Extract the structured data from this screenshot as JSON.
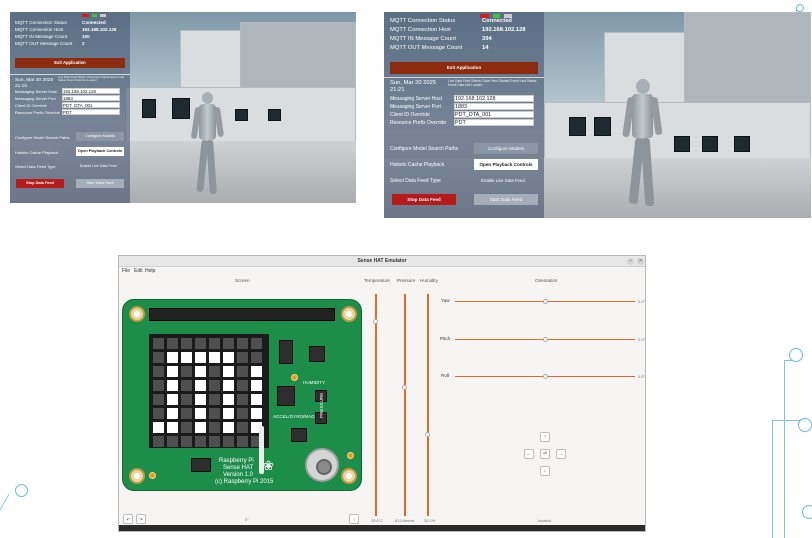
{
  "scene_small": {
    "status": {
      "rows": [
        {
          "label": "MQTT Connection Status",
          "value": "Connected"
        },
        {
          "label": "MQTT Connection Host",
          "value": "192.168.102.128"
        },
        {
          "label": "MQTT IN Message Count",
          "value": "100"
        },
        {
          "label": "MQTT OUT Message Count",
          "value": "2"
        }
      ],
      "exit_button": "Exit Application"
    },
    "date": "Sun, Mar 30 2025 21:15",
    "notice": "Live Data Feed Status: Data Feed Started  Event Last Status: Event Data Not Loaded",
    "settings": [
      {
        "label": "Messaging Server Host",
        "value": "192.168.102.128"
      },
      {
        "label": "Messaging Server Port",
        "value": "1883"
      },
      {
        "label": "Client ID Override",
        "value": "PDT_DTA_001"
      },
      {
        "label": "Resource Prefix Override",
        "value": "PDT"
      }
    ],
    "buttons": {
      "configure_label": "Configure Model Search Paths",
      "configure_button": "Configure Models",
      "playback_label": "Historic Cache Playback",
      "playback_button": "Open Playback Controls",
      "feed_type_label": "Select Data Feed Type",
      "feed_type_value": "Enable Live Data Feed",
      "stop_button": "Stop Data Feed",
      "start_button": "Start Data Feed"
    }
  },
  "scene_large": {
    "status": {
      "rows": [
        {
          "label": "MQTT Connection Status",
          "value": "Connected"
        },
        {
          "label": "MQTT Connection Host",
          "value": "192.168.102.128"
        },
        {
          "label": "MQTT IN Message Count",
          "value": "394"
        },
        {
          "label": "MQTT OUT Message Count",
          "value": "14"
        }
      ],
      "exit_button": "Exit Application"
    },
    "date": "Sun, Mar 30 2025 21:21",
    "notice": "Live Data Feed Status: Data Feed Started  Event Last Status: Event Data Not Loaded",
    "settings": [
      {
        "label": "Messaging Server Host",
        "value": "192.168.102.128"
      },
      {
        "label": "Messaging Server Port",
        "value": "1883"
      },
      {
        "label": "Client ID Override",
        "value": "PDT_DTA_001"
      },
      {
        "label": "Resource Prefix Override",
        "value": "PDT"
      }
    ],
    "buttons": {
      "configure_label": "Configure Model Search Paths",
      "configure_button": "Configure Models",
      "playback_label": "Historic Cache Playback",
      "playback_button": "Open Playback Controls",
      "feed_type_label": "Select Data Feed Type",
      "feed_type_value": "Enable Live Data Feed",
      "stop_button": "Stop Data Feed",
      "start_button": "Start Data Feed"
    }
  },
  "emulator": {
    "title": "Sense HAT Emulator",
    "menu": [
      "File",
      "Edit",
      "Help"
    ],
    "headers": {
      "screen": "Screen",
      "temperature": "Temperature",
      "pressure": "Pressure",
      "humidity": "Humidity",
      "orientation": "Orientation"
    },
    "board_text": {
      "humidity": "HUMIDITY",
      "pressure": "PRESSURE",
      "accel": "ACCEL/GYRO/MAG",
      "line1": "Raspberry Pi",
      "line2": "Sense HAT",
      "line3": "Version 1.0",
      "line4": "(c) Raspberry Pi 2015"
    },
    "readings": {
      "temperature": "25.0°C",
      "pressure": "813.6mbar",
      "humidity": "26.1%"
    },
    "levels": {
      "temperature": 0.12,
      "pressure": 0.42,
      "humidity": 0.63
    },
    "orientation": [
      {
        "name": "Yaw",
        "value": "0.0°",
        "fraction": 0.5
      },
      {
        "name": "Pitch",
        "value": "0.0°",
        "fraction": 0.5
      },
      {
        "name": "Roll",
        "value": "0.0°",
        "fraction": 0.5
      }
    ],
    "rotation": "0°",
    "joystick_label": "Joystick",
    "joystick_buttons": {
      "up": "↑",
      "left": "←",
      "enter": "⏎",
      "right": "→",
      "down": "↓"
    },
    "led_pattern": [
      "00000000",
      "01111100",
      "01010101",
      "01010101",
      "01010101",
      "01010101",
      "11010101",
      "00000000"
    ],
    "colors": {
      "board": "#1d8d4a",
      "slider": "#e06a2b",
      "led_on": "#ffffff",
      "led_off": "#4f4f4f"
    }
  }
}
